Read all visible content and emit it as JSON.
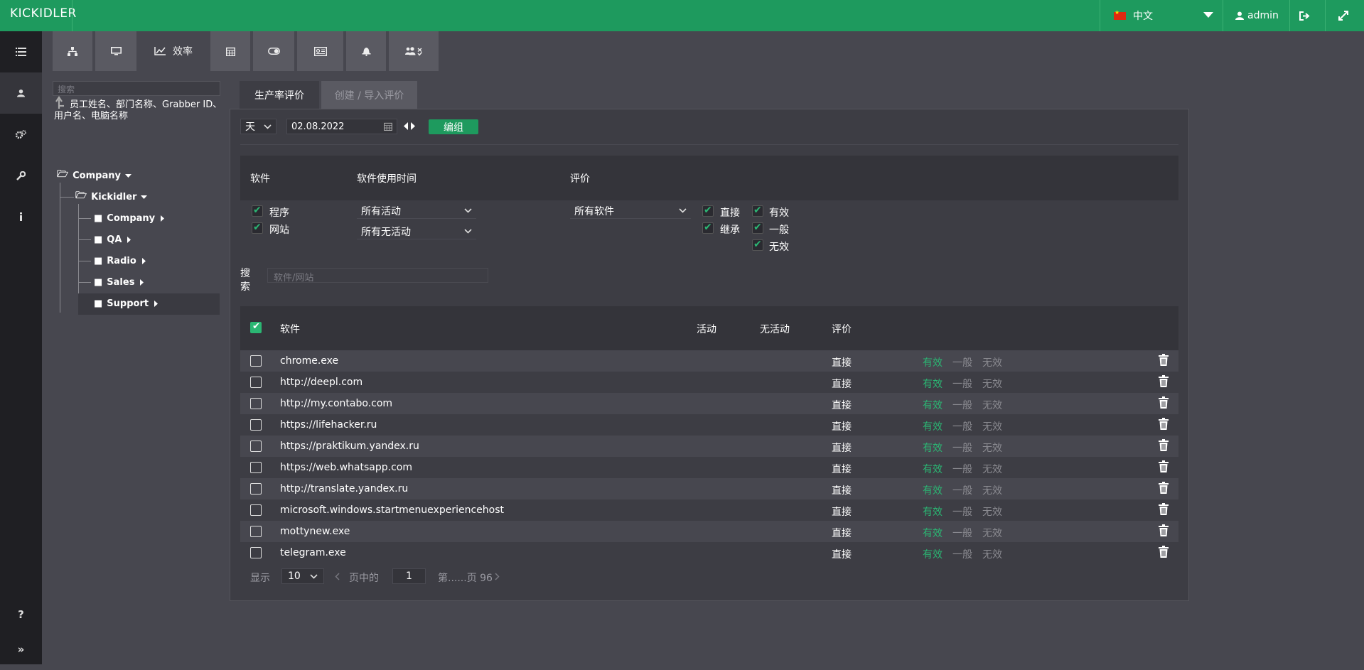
{
  "topbar": {
    "logo": "KICKIDLER",
    "language": "中文",
    "user": "admin"
  },
  "top_tabs": [
    {
      "label": "",
      "icon": "sitemap-icon"
    },
    {
      "label": "",
      "icon": "monitor-icon"
    },
    {
      "label": "效率",
      "icon": "line-chart-icon"
    },
    {
      "label": "",
      "icon": "calendar-icon"
    },
    {
      "label": "",
      "icon": "toggle-icon"
    },
    {
      "label": "",
      "icon": "id-card-icon"
    },
    {
      "label": "",
      "icon": "bell-icon"
    },
    {
      "label": "",
      "icon": "users-cog-icon"
    }
  ],
  "sidebar": {
    "search_placeholder": "搜索",
    "search_hint": "员工姓名、部门名称、Grabber ID、用户名、电脑名称",
    "tree": {
      "root": "Company",
      "child": "Kickidler",
      "groups": [
        "Company",
        "QA",
        "Radio",
        "Sales",
        "Support"
      ]
    }
  },
  "main": {
    "tabs": [
      "生产率评价",
      "创建 / 导入评价"
    ],
    "period_select": "天",
    "date_value": "02.08.2022",
    "edit_button": "编组",
    "filters": {
      "col_software": "软件",
      "col_usage_time": "软件使用时间",
      "col_rating": "评价",
      "type_program": "程序",
      "type_website": "网站",
      "activity_select": "所有活动",
      "inactivity_select": "所有无活动",
      "software_select": "所有软件",
      "direct": "直接",
      "inherited": "继承",
      "effective": "有效",
      "normal": "一般",
      "ineffective": "无效"
    },
    "search_label": "搜索",
    "search_placeholder": "软件/网站",
    "table": {
      "headers": {
        "software": "软件",
        "active": "活动",
        "inactive": "无活动",
        "rating": "评价"
      },
      "rows": [
        {
          "name": "chrome.exe",
          "source": "直接"
        },
        {
          "name": "http://deepl.com",
          "source": "直接"
        },
        {
          "name": "http://my.contabo.com",
          "source": "直接"
        },
        {
          "name": "https://lifehacker.ru",
          "source": "直接"
        },
        {
          "name": "https://praktikum.yandex.ru",
          "source": "直接"
        },
        {
          "name": "https://web.whatsapp.com",
          "source": "直接"
        },
        {
          "name": "http://translate.yandex.ru",
          "source": "直接"
        },
        {
          "name": "microsoft.windows.startmenuexperiencehost",
          "source": "直接"
        },
        {
          "name": "mottynew.exe",
          "source": "直接"
        },
        {
          "name": "telegram.exe",
          "source": "直接"
        }
      ],
      "rating_options": [
        "有效",
        "一般",
        "无效"
      ]
    },
    "pager": {
      "show_label": "显示",
      "page_size": "10",
      "page_of_label": "页中的",
      "current_page": "1",
      "total_label": "第......页 96"
    }
  },
  "colors": {
    "accent": "#1e9a5e",
    "effective": "#2bb673"
  }
}
